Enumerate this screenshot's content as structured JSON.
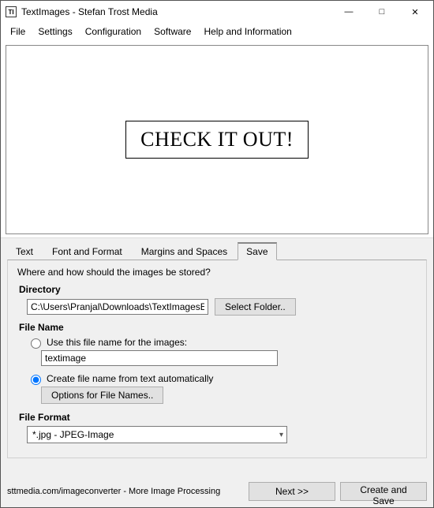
{
  "window": {
    "title": "TextImages - Stefan Trost Media",
    "icon_label": "TI"
  },
  "menu": {
    "items": [
      "File",
      "Settings",
      "Configuration",
      "Software",
      "Help and Information"
    ]
  },
  "preview": {
    "text": "CHECK IT OUT!"
  },
  "tabs": {
    "items": [
      "Text",
      "Font and Format",
      "Margins and Spaces",
      "Save"
    ],
    "active_index": 3
  },
  "save_panel": {
    "question": "Where and how should the images be stored?",
    "directory": {
      "label": "Directory",
      "path": "C:\\Users\\Pranjal\\Downloads\\TextImagesEn\\o",
      "button": "Select Folder.."
    },
    "filename": {
      "label": "File Name",
      "option_fixed": "Use this file name for the images:",
      "fixed_value": "textimage",
      "option_auto": "Create file name from text automatically",
      "options_button": "Options for File Names.."
    },
    "fileformat": {
      "label": "File Format",
      "value": "*.jpg - JPEG-Image"
    }
  },
  "footer": {
    "link_text": "sttmedia.com/imageconverter - More Image Processing",
    "next": "Next >>",
    "create": "Create and Save"
  }
}
